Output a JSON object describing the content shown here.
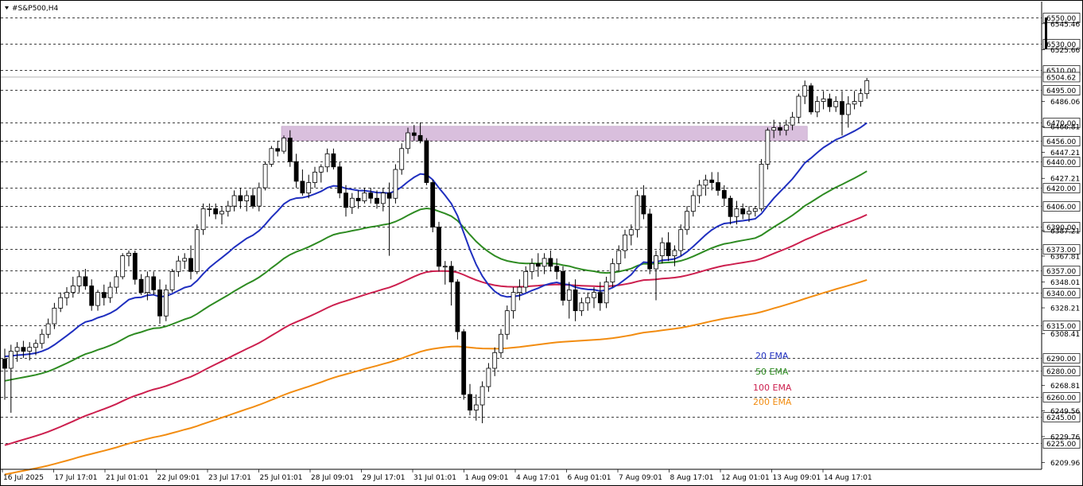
{
  "header": {
    "symbol_label": "#S&P500,H4"
  },
  "colors": {
    "bull": "#ffffff",
    "bear": "#000000",
    "wick": "#000000",
    "zone": "#d9bfdd",
    "ema20": "#1f2fbf",
    "ema50": "#2e8b22",
    "ema100": "#cc1f4e",
    "ema200": "#f28c10",
    "grid": "#000000"
  },
  "chart_data": {
    "type": "candlestick",
    "title": "#S&P500,H4",
    "ylim": [
      6207.2,
      6557.5
    ],
    "grid": "horizontal dashed at labelled price levels",
    "price_levels": [
      6550,
      6530,
      6510,
      6495,
      6470,
      6456,
      6440,
      6420,
      6406,
      6390,
      6373,
      6357,
      6340,
      6315,
      6290,
      6280,
      6260,
      6245,
      6225
    ],
    "intermediate_ticks": [
      "6545.46",
      "6525.66",
      "6504.62",
      "6486.06",
      "6466.81",
      "6447.21",
      "6427.21",
      "6387.21",
      "6367.81",
      "6348.01",
      "6328.21",
      "6308.41",
      "6268.81",
      "6249.56",
      "6229.76",
      "6209.96"
    ],
    "current_price": "6504.62",
    "x_labels": [
      "16 Jul 2025",
      "17 Jul 17:01",
      "21 Jul 01:01",
      "22 Jul 09:01",
      "23 Jul 17:01",
      "25 Jul 01:01",
      "28 Jul 09:01",
      "29 Jul 17:01",
      "31 Jul 01:01",
      "1 Aug 09:01",
      "4 Aug 17:01",
      "6 Aug 01:01",
      "7 Aug 09:01",
      "8 Aug 17:01",
      "12 Aug 01:01",
      "13 Aug 09:01",
      "14 Aug 17:01"
    ],
    "zone": {
      "from_index": 45,
      "to_index": 129,
      "top": 6467,
      "bottom": 6456
    },
    "legend": [
      {
        "name": "20 EMA",
        "color": "#1f2fbf"
      },
      {
        "name": "50 EMA",
        "color": "#2e8b22"
      },
      {
        "name": "100 EMA",
        "color": "#cc1f4e"
      },
      {
        "name": "200 EMA",
        "color": "#f28c10"
      }
    ],
    "candles": [
      [
        6289,
        6297,
        6258,
        6282
      ],
      [
        6282,
        6300,
        6248,
        6295
      ],
      [
        6295,
        6302,
        6287,
        6298
      ],
      [
        6298,
        6303,
        6290,
        6295
      ],
      [
        6295,
        6302,
        6288,
        6298
      ],
      [
        6298,
        6304,
        6292,
        6301
      ],
      [
        6301,
        6312,
        6297,
        6308
      ],
      [
        6308,
        6320,
        6305,
        6316
      ],
      [
        6316,
        6332,
        6312,
        6328
      ],
      [
        6328,
        6340,
        6325,
        6336
      ],
      [
        6336,
        6344,
        6330,
        6340
      ],
      [
        6340,
        6352,
        6336,
        6345
      ],
      [
        6345,
        6356,
        6340,
        6352
      ],
      [
        6352,
        6358,
        6342,
        6345
      ],
      [
        6345,
        6350,
        6326,
        6330
      ],
      [
        6330,
        6342,
        6326,
        6340
      ],
      [
        6340,
        6346,
        6330,
        6336
      ],
      [
        6336,
        6348,
        6332,
        6344
      ],
      [
        6344,
        6356,
        6340,
        6352
      ],
      [
        6352,
        6370,
        6350,
        6368
      ],
      [
        6368,
        6372,
        6360,
        6370
      ],
      [
        6370,
        6372,
        6346,
        6350
      ],
      [
        6350,
        6354,
        6338,
        6340
      ],
      [
        6340,
        6356,
        6334,
        6352
      ],
      [
        6352,
        6356,
        6338,
        6342
      ],
      [
        6342,
        6350,
        6316,
        6322
      ],
      [
        6322,
        6346,
        6318,
        6342
      ],
      [
        6342,
        6358,
        6340,
        6356
      ],
      [
        6356,
        6368,
        6352,
        6364
      ],
      [
        6364,
        6370,
        6358,
        6366
      ],
      [
        6366,
        6376,
        6350,
        6356
      ],
      [
        6356,
        6392,
        6354,
        6388
      ],
      [
        6388,
        6408,
        6384,
        6404
      ],
      [
        6404,
        6408,
        6398,
        6404
      ],
      [
        6404,
        6408,
        6396,
        6400
      ],
      [
        6400,
        6406,
        6392,
        6402
      ],
      [
        6402,
        6410,
        6398,
        6406
      ],
      [
        6406,
        6418,
        6402,
        6414
      ],
      [
        6414,
        6420,
        6404,
        6410
      ],
      [
        6410,
        6418,
        6402,
        6414
      ],
      [
        6414,
        6420,
        6404,
        6406
      ],
      [
        6406,
        6424,
        6402,
        6420
      ],
      [
        6420,
        6440,
        6418,
        6438
      ],
      [
        6438,
        6452,
        6436,
        6450
      ],
      [
        6450,
        6456,
        6444,
        6448
      ],
      [
        6448,
        6460,
        6446,
        6458
      ],
      [
        6458,
        6464,
        6436,
        6440
      ],
      [
        6440,
        6446,
        6420,
        6425
      ],
      [
        6425,
        6434,
        6414,
        6416
      ],
      [
        6416,
        6430,
        6412,
        6424
      ],
      [
        6424,
        6436,
        6420,
        6432
      ],
      [
        6432,
        6438,
        6424,
        6436
      ],
      [
        6436,
        6450,
        6432,
        6446
      ],
      [
        6446,
        6450,
        6434,
        6436
      ],
      [
        6436,
        6440,
        6412,
        6416
      ],
      [
        6416,
        6422,
        6398,
        6405
      ],
      [
        6405,
        6416,
        6400,
        6412
      ],
      [
        6412,
        6418,
        6404,
        6410
      ],
      [
        6410,
        6420,
        6408,
        6416
      ],
      [
        6416,
        6420,
        6408,
        6412
      ],
      [
        6412,
        6418,
        6404,
        6408
      ],
      [
        6408,
        6420,
        6402,
        6416
      ],
      [
        6416,
        6424,
        6368,
        6412
      ],
      [
        6412,
        6438,
        6408,
        6434
      ],
      [
        6434,
        6454,
        6430,
        6450
      ],
      [
        6450,
        6466,
        6446,
        6462
      ],
      [
        6462,
        6468,
        6456,
        6460
      ],
      [
        6460,
        6470,
        6454,
        6456
      ],
      [
        6456,
        6458,
        6422,
        6424
      ],
      [
        6424,
        6426,
        6386,
        6390
      ],
      [
        6390,
        6394,
        6356,
        6360
      ],
      [
        6360,
        6364,
        6346,
        6360
      ],
      [
        6360,
        6364,
        6330,
        6348
      ],
      [
        6348,
        6350,
        6304,
        6310
      ],
      [
        6310,
        6312,
        6258,
        6262
      ],
      [
        6262,
        6270,
        6246,
        6250
      ],
      [
        6250,
        6262,
        6242,
        6254
      ],
      [
        6254,
        6272,
        6240,
        6268
      ],
      [
        6268,
        6286,
        6264,
        6282
      ],
      [
        6282,
        6298,
        6276,
        6294
      ],
      [
        6294,
        6312,
        6290,
        6308
      ],
      [
        6308,
        6330,
        6304,
        6326
      ],
      [
        6326,
        6344,
        6320,
        6340
      ],
      [
        6340,
        6350,
        6334,
        6344
      ],
      [
        6344,
        6360,
        6340,
        6356
      ],
      [
        6356,
        6366,
        6350,
        6362
      ],
      [
        6362,
        6370,
        6352,
        6360
      ],
      [
        6360,
        6370,
        6354,
        6366
      ],
      [
        6366,
        6372,
        6356,
        6360
      ],
      [
        6360,
        6366,
        6350,
        6356
      ],
      [
        6356,
        6360,
        6330,
        6334
      ],
      [
        6334,
        6348,
        6320,
        6342
      ],
      [
        6342,
        6350,
        6318,
        6326
      ],
      [
        6326,
        6336,
        6322,
        6332
      ],
      [
        6332,
        6340,
        6326,
        6336
      ],
      [
        6336,
        6344,
        6328,
        6340
      ],
      [
        6340,
        6348,
        6326,
        6332
      ],
      [
        6332,
        6352,
        6328,
        6348
      ],
      [
        6348,
        6366,
        6344,
        6362
      ],
      [
        6362,
        6376,
        6356,
        6372
      ],
      [
        6372,
        6388,
        6366,
        6384
      ],
      [
        6384,
        6392,
        6376,
        6388
      ],
      [
        6388,
        6418,
        6382,
        6414
      ],
      [
        6414,
        6422,
        6396,
        6400
      ],
      [
        6400,
        6404,
        6354,
        6358
      ],
      [
        6358,
        6372,
        6334,
        6368
      ],
      [
        6368,
        6382,
        6362,
        6378
      ],
      [
        6378,
        6386,
        6364,
        6368
      ],
      [
        6368,
        6376,
        6360,
        6372
      ],
      [
        6372,
        6392,
        6368,
        6388
      ],
      [
        6388,
        6406,
        6384,
        6402
      ],
      [
        6402,
        6418,
        6398,
        6414
      ],
      [
        6414,
        6426,
        6408,
        6422
      ],
      [
        6422,
        6430,
        6414,
        6426
      ],
      [
        6426,
        6432,
        6418,
        6424
      ],
      [
        6424,
        6432,
        6414,
        6418
      ],
      [
        6418,
        6422,
        6406,
        6412
      ],
      [
        6412,
        6414,
        6392,
        6398
      ],
      [
        6398,
        6410,
        6392,
        6404
      ],
      [
        6404,
        6408,
        6396,
        6400
      ],
      [
        6400,
        6406,
        6394,
        6402
      ],
      [
        6402,
        6406,
        6398,
        6404
      ],
      [
        6404,
        6442,
        6402,
        6438
      ],
      [
        6438,
        6466,
        6434,
        6464
      ],
      [
        6464,
        6472,
        6458,
        6466
      ],
      [
        6466,
        6470,
        6460,
        6464
      ],
      [
        6464,
        6472,
        6460,
        6468
      ],
      [
        6468,
        6478,
        6464,
        6474
      ],
      [
        6474,
        6492,
        6470,
        6490
      ],
      [
        6490,
        6502,
        6484,
        6498
      ],
      [
        6498,
        6500,
        6476,
        6478
      ],
      [
        6478,
        6490,
        6474,
        6486
      ],
      [
        6486,
        6494,
        6480,
        6488
      ],
      [
        6488,
        6492,
        6478,
        6482
      ],
      [
        6482,
        6490,
        6478,
        6486
      ],
      [
        6486,
        6494,
        6460,
        6476
      ],
      [
        6476,
        6490,
        6466,
        6484
      ],
      [
        6484,
        6494,
        6480,
        6486
      ],
      [
        6486,
        6496,
        6482,
        6492
      ],
      [
        6492,
        6504,
        6488,
        6502
      ]
    ]
  }
}
